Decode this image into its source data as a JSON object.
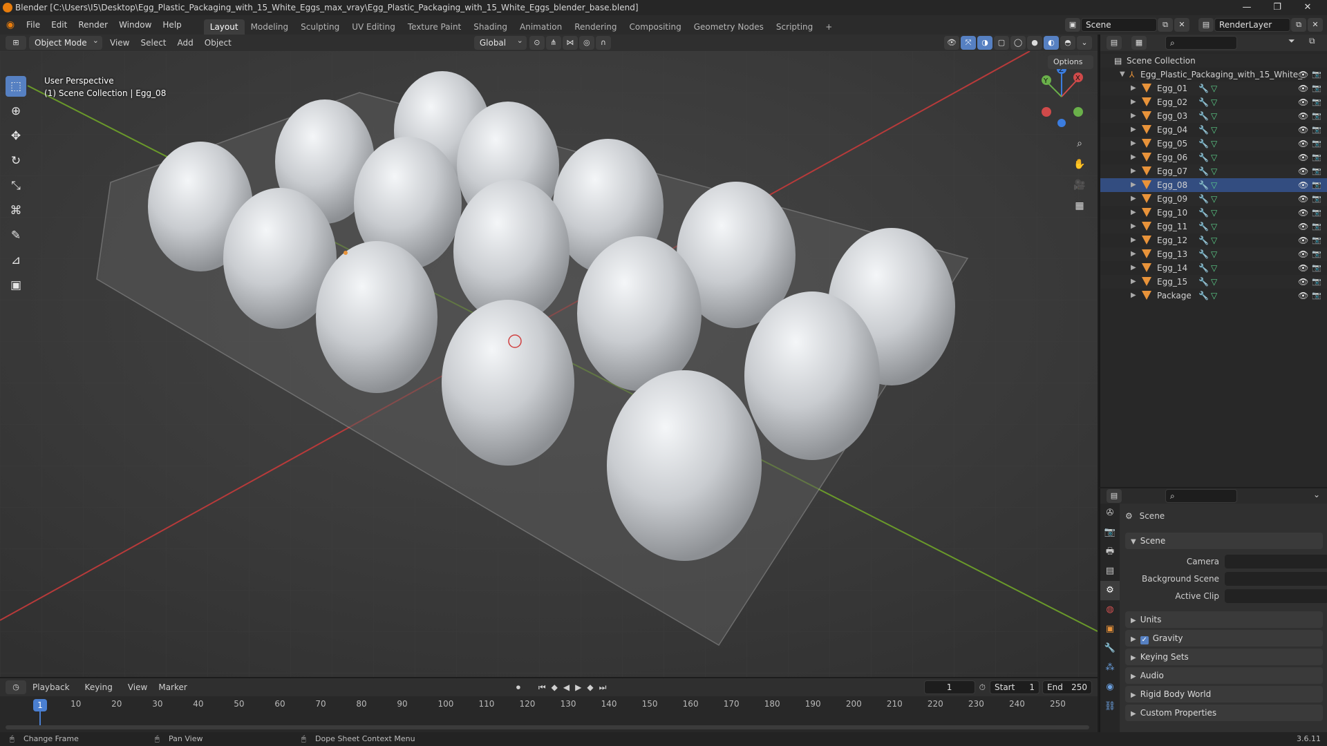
{
  "window": {
    "title": "Blender [C:\\Users\\I5\\Desktop\\Egg_Plastic_Packaging_with_15_White_Eggs_max_vray\\Egg_Plastic_Packaging_with_15_White_Eggs_blender_base.blend]",
    "minimize": "—",
    "maximize": "❐",
    "close": "✕"
  },
  "menu": {
    "items": [
      "File",
      "Edit",
      "Render",
      "Window",
      "Help"
    ]
  },
  "workspaces": {
    "tabs": [
      "Layout",
      "Modeling",
      "Sculpting",
      "UV Editing",
      "Texture Paint",
      "Shading",
      "Animation",
      "Rendering",
      "Compositing",
      "Geometry Nodes",
      "Scripting"
    ],
    "active": "Layout",
    "add": "+"
  },
  "scene_selector": {
    "value": "Scene"
  },
  "view_layer_selector": {
    "value": "RenderLayer"
  },
  "viewport_header": {
    "mode": "Object Mode",
    "menus": [
      "View",
      "Select",
      "Add",
      "Object"
    ],
    "transform_orientation": "Global"
  },
  "viewport": {
    "perspective_label": "User Perspective",
    "context_label": "(1) Scene Collection | Egg_08",
    "options_label": "Options",
    "gizmo": {
      "x": "X",
      "y": "Y",
      "z": "Z"
    }
  },
  "outliner": {
    "root": "Scene Collection",
    "collection": "Egg_Plastic_Packaging_with_15_White_",
    "objects": [
      "Egg_01",
      "Egg_02",
      "Egg_03",
      "Egg_04",
      "Egg_05",
      "Egg_06",
      "Egg_07",
      "Egg_08",
      "Egg_09",
      "Egg_10",
      "Egg_11",
      "Egg_12",
      "Egg_13",
      "Egg_14",
      "Egg_15",
      "Package"
    ],
    "active_object": "Egg_08"
  },
  "properties": {
    "context_title": "Scene",
    "scene_panel": "Scene",
    "camera_label": "Camera",
    "background_scene_label": "Background Scene",
    "active_clip_label": "Active Clip",
    "panels": [
      "Units",
      "Gravity",
      "Keying Sets",
      "Audio",
      "Rigid Body World",
      "Custom Properties"
    ],
    "gravity_checked": true
  },
  "timeline": {
    "menus": [
      "Playback",
      "Keying",
      "View",
      "Marker"
    ],
    "current_frame": "1",
    "start_label": "Start",
    "start_value": "1",
    "end_label": "End",
    "end_value": "250",
    "ticks": [
      "1",
      "10",
      "20",
      "30",
      "40",
      "50",
      "60",
      "70",
      "80",
      "90",
      "100",
      "110",
      "120",
      "130",
      "140",
      "150",
      "160",
      "170",
      "180",
      "190",
      "200",
      "210",
      "220",
      "230",
      "240",
      "250"
    ]
  },
  "statusbar": {
    "hint1": "Change Frame",
    "hint2": "Pan View",
    "hint3": "Dope Sheet Context Menu",
    "version": "3.6.11"
  },
  "colors": {
    "accent": "#5680c2",
    "object_orange": "#e8933a",
    "mesh_green": "#5cd08a",
    "axis_red": "#b83a3a",
    "axis_green": "#6a9a2a"
  }
}
